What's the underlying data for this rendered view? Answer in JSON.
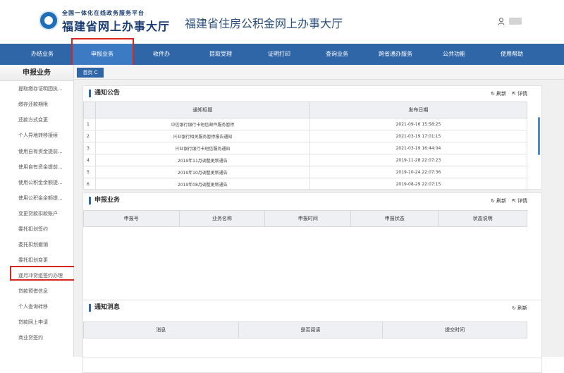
{
  "header": {
    "logo_line1": "全国一体化在线政务服务平台",
    "logo_line2": "福建省网上办事大厅",
    "site_title": "福建省住房公积金网上办事大厅"
  },
  "nav": {
    "items": [
      "办结业务",
      "申报业务",
      "收件办",
      "提取受理",
      "证明打印",
      "查询业务",
      "跨省通办服务",
      "公共功能",
      "使用帮助"
    ],
    "active": "申报业务"
  },
  "sidebar": {
    "title": "申报业务",
    "items": [
      "提取缴存证明团执...",
      "缴存还款期限",
      "还款方式变更",
      "个人异地转移接续",
      "使用自有资金提前...",
      "使用自有资金提前...",
      "使用公积金余额提...",
      "使用公积金余额提...",
      "变更贷款扣款账户",
      "委托扣划签约",
      "委托扣划撤销",
      "委托扣划变更",
      "逐月冲贷组签约办理",
      "贷款预借信息",
      "个人查询转移",
      "贷款网上申请",
      "商业贷签约"
    ],
    "highlighted": "逐月冲贷组签约办理"
  },
  "tabs": {
    "home": "首页 C"
  },
  "notice": {
    "title": "通知公告",
    "refresh": "刷新",
    "detail": "详情",
    "headers": [
      "通知标题",
      "发布日期"
    ],
    "rows": [
      {
        "no": "1",
        "title": "中信银行银行卡短信邮件服务暂停",
        "date": "2021-09-16 15:58:25"
      },
      {
        "no": "2",
        "title": "兴业银行相关服务暂停报告通知",
        "date": "2021-03-19 17:01:15"
      },
      {
        "no": "3",
        "title": "兴业银行银行卡短信服务通知",
        "date": "2021-03-19 16:44:04"
      },
      {
        "no": "4",
        "title": "2019年11月调整更新通告",
        "date": "2019-11-28 22:07:23"
      },
      {
        "no": "5",
        "title": "2019年10月调整更新通告",
        "date": "2019-10-24 22:07:36"
      },
      {
        "no": "6",
        "title": "2019年08月调整更新通告",
        "date": "2019-08-29 22:07:15"
      }
    ]
  },
  "declare": {
    "title": "申报业务",
    "refresh": "刷新",
    "detail": "详情",
    "headers": [
      "申报号",
      "业务名称",
      "申报时间",
      "申报状态",
      "状态说明"
    ]
  },
  "messages": {
    "title": "通知消息",
    "refresh": "刷新",
    "headers": [
      "消息",
      "是否阅读",
      "提交时间"
    ]
  },
  "colors": {
    "nav_bg": "#2f66a8",
    "highlight_box": "#d9261c",
    "accent": "#2f66a8"
  }
}
